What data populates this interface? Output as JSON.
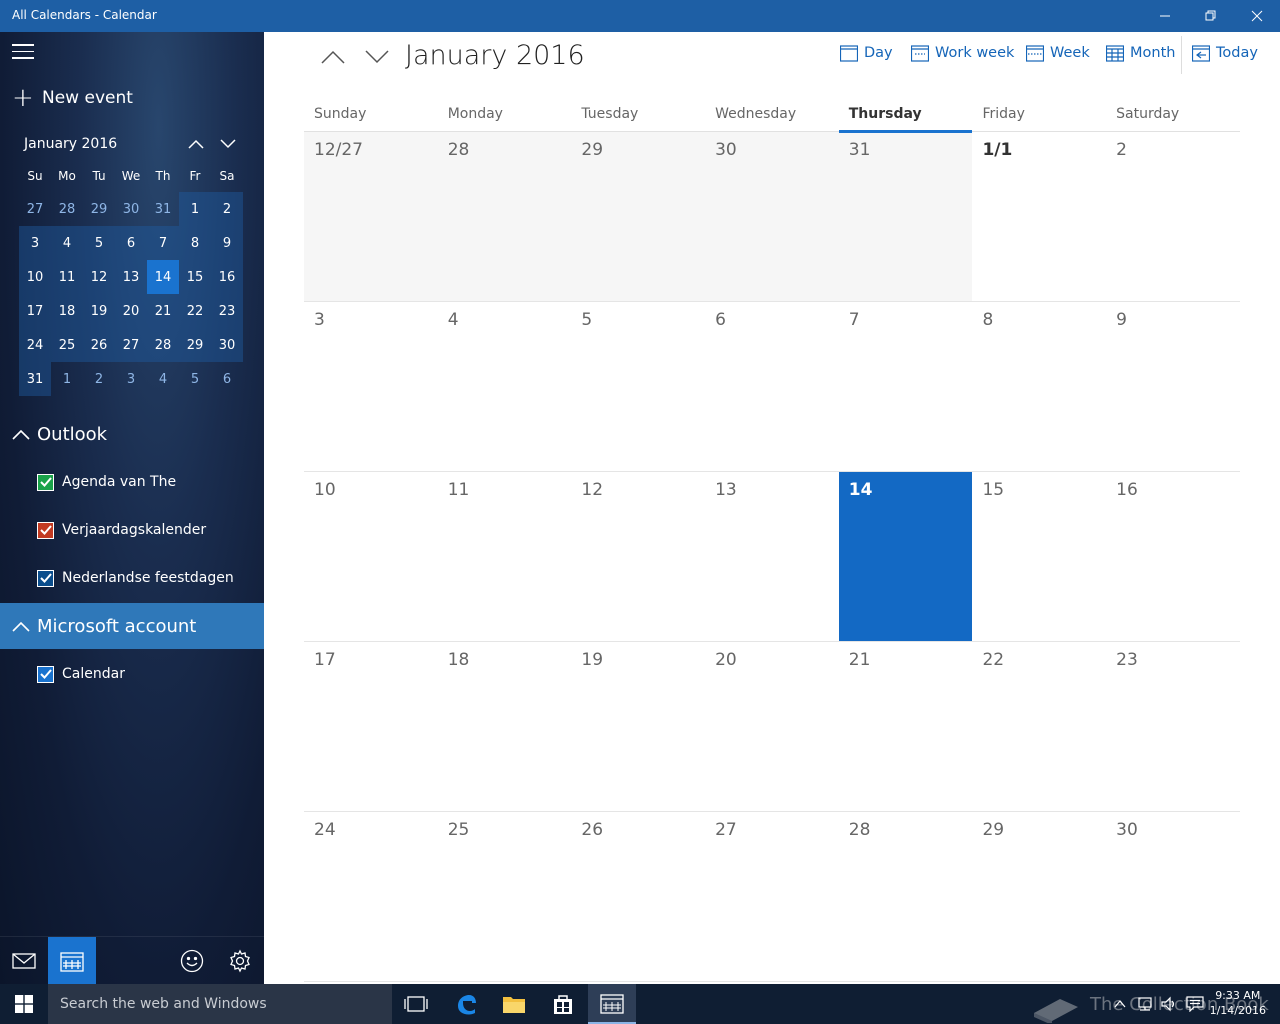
{
  "window": {
    "title": "All Calendars - Calendar"
  },
  "sidebar": {
    "new_event": "New event",
    "mini_calendar": {
      "title": "January 2016",
      "days_of_week": [
        "Su",
        "Mo",
        "Tu",
        "We",
        "Th",
        "Fr",
        "Sa"
      ],
      "weeks": [
        [
          "27",
          "28",
          "29",
          "30",
          "31",
          "1",
          "2"
        ],
        [
          "3",
          "4",
          "5",
          "6",
          "7",
          "8",
          "9"
        ],
        [
          "10",
          "11",
          "12",
          "13",
          "14",
          "15",
          "16"
        ],
        [
          "17",
          "18",
          "19",
          "20",
          "21",
          "22",
          "23"
        ],
        [
          "24",
          "25",
          "26",
          "27",
          "28",
          "29",
          "30"
        ],
        [
          "31",
          "1",
          "2",
          "3",
          "4",
          "5",
          "6"
        ]
      ],
      "today": "14"
    },
    "groups": [
      {
        "name": "Outlook",
        "calendars": [
          {
            "name": "Agenda van The",
            "color": "#1aa34a"
          },
          {
            "name": "Verjaardagskalender",
            "color": "#c23a22"
          },
          {
            "name": "Nederlandse feestdagen",
            "color": "#0a4d8c"
          }
        ]
      },
      {
        "name": "Microsoft account",
        "calendars": [
          {
            "name": "Calendar",
            "color": "#1a73cf"
          }
        ]
      }
    ],
    "bottom_icons": [
      "mail-icon",
      "calendar-icon",
      "smiley-icon",
      "gear-icon"
    ]
  },
  "main": {
    "month_title": "January 2016",
    "views": {
      "day": "Day",
      "work_week": "Work week",
      "week": "Week",
      "month": "Month",
      "today": "Today"
    },
    "days_of_week": [
      "Sunday",
      "Monday",
      "Tuesday",
      "Wednesday",
      "Thursday",
      "Friday",
      "Saturday"
    ],
    "weeks": [
      [
        "12/27",
        "28",
        "29",
        "30",
        "31",
        "1/1",
        "2"
      ],
      [
        "3",
        "4",
        "5",
        "6",
        "7",
        "8",
        "9"
      ],
      [
        "10",
        "11",
        "12",
        "13",
        "14",
        "15",
        "16"
      ],
      [
        "17",
        "18",
        "19",
        "20",
        "21",
        "22",
        "23"
      ],
      [
        "24",
        "25",
        "26",
        "27",
        "28",
        "29",
        "30"
      ]
    ],
    "today": "14",
    "accent_color": "#1369c4"
  },
  "taskbar": {
    "search_placeholder": "Search the web and Windows",
    "time": "9:33 AM",
    "date": "1/14/2016",
    "watermark": "The Collection Book"
  }
}
